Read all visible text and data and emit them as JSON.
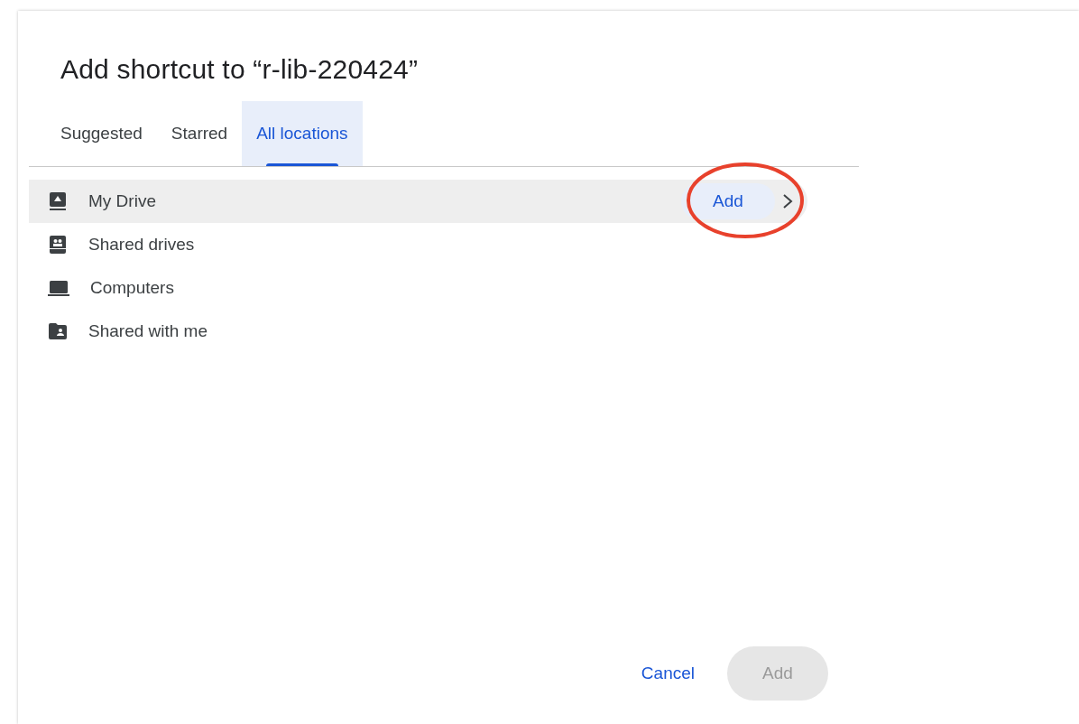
{
  "dialog": {
    "title": "Add shortcut to “r-lib-220424”"
  },
  "tabs": [
    {
      "label": "Suggested",
      "selected": false
    },
    {
      "label": "Starred",
      "selected": false
    },
    {
      "label": "All locations",
      "selected": true
    }
  ],
  "locations": [
    {
      "label": "My Drive",
      "kind": "drive",
      "selected": true,
      "action": "Add"
    },
    {
      "label": "Shared drives",
      "kind": "shared-drive",
      "selected": false
    },
    {
      "label": "Computers",
      "kind": "computer",
      "selected": false
    },
    {
      "label": "Shared with me",
      "kind": "shared-folder",
      "selected": false
    }
  ],
  "footer": {
    "cancel": "Cancel",
    "add": {
      "label": "Add",
      "disabled": true
    }
  }
}
